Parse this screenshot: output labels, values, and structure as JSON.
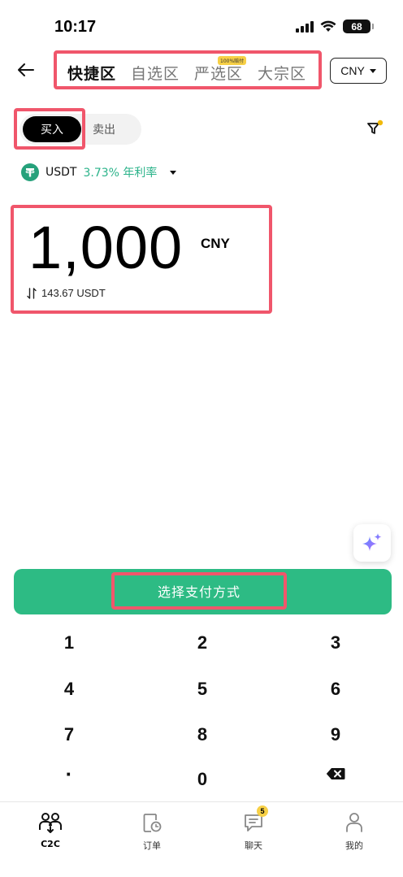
{
  "status_bar": {
    "time": "10:17",
    "battery": "68"
  },
  "header": {
    "tabs": [
      {
        "label": "快捷区",
        "active": true
      },
      {
        "label": "自选区",
        "active": false
      },
      {
        "label": "严选区",
        "active": false,
        "badge": "100%赔付"
      },
      {
        "label": "大宗区",
        "active": false
      }
    ],
    "currency": "CNY"
  },
  "mode": {
    "buy_label": "买入",
    "sell_label": "卖出",
    "selected": "buy"
  },
  "asset": {
    "name": "USDT",
    "rate": "3.73% 年利率"
  },
  "amount": {
    "value": "1,000",
    "unit": "CNY",
    "converted": "143.67 USDT"
  },
  "pay_button": {
    "label": "选择支付方式"
  },
  "keypad": {
    "keys": [
      "1",
      "2",
      "3",
      "4",
      "5",
      "6",
      "7",
      "8",
      "9",
      "·",
      "0",
      "delete"
    ]
  },
  "bottom_nav": {
    "items": [
      {
        "label": "C2C",
        "icon": "users-icon",
        "active": true
      },
      {
        "label": "订单",
        "icon": "order-clock-icon",
        "active": false
      },
      {
        "label": "聊天",
        "icon": "chat-icon",
        "active": false,
        "badge": "5"
      },
      {
        "label": "我的",
        "icon": "profile-icon",
        "active": false
      }
    ]
  },
  "colors": {
    "accent_green": "#2dbb84",
    "highlight_red": "#f0566b",
    "badge_yellow": "#f7d046",
    "usdt_green": "#26a17b"
  }
}
